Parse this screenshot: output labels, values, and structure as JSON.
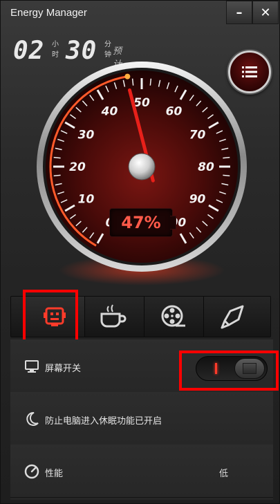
{
  "window": {
    "title": "Energy Manager",
    "minimize_label": "–",
    "close_label": "✕"
  },
  "time": {
    "hours": "02",
    "hours_unit": "小时",
    "minutes": "30",
    "minutes_unit": "分钟",
    "available_label": "预计可用"
  },
  "gauge": {
    "ticks": [
      "0",
      "10",
      "20",
      "30",
      "40",
      "50",
      "60",
      "70",
      "80",
      "90",
      "100"
    ],
    "value": 47,
    "percent_text": "47%",
    "accent": "#ff3b2a"
  },
  "tabs": [
    {
      "name": "smart",
      "icon": "robot-face-icon",
      "active": true
    },
    {
      "name": "entertainment",
      "icon": "coffee-cup-icon",
      "active": false
    },
    {
      "name": "movie",
      "icon": "film-reel-icon",
      "active": false
    },
    {
      "name": "performance",
      "icon": "rocket-icon",
      "active": false
    }
  ],
  "settings": {
    "screen_label": "屏幕开关",
    "screen_toggle_on": true,
    "sleep_label": "防止电脑进入休眠功能已开启",
    "performance_label": "性能",
    "performance_value": "低"
  },
  "colors": {
    "highlight": "#ff0000",
    "accent": "#ff3b2a"
  }
}
